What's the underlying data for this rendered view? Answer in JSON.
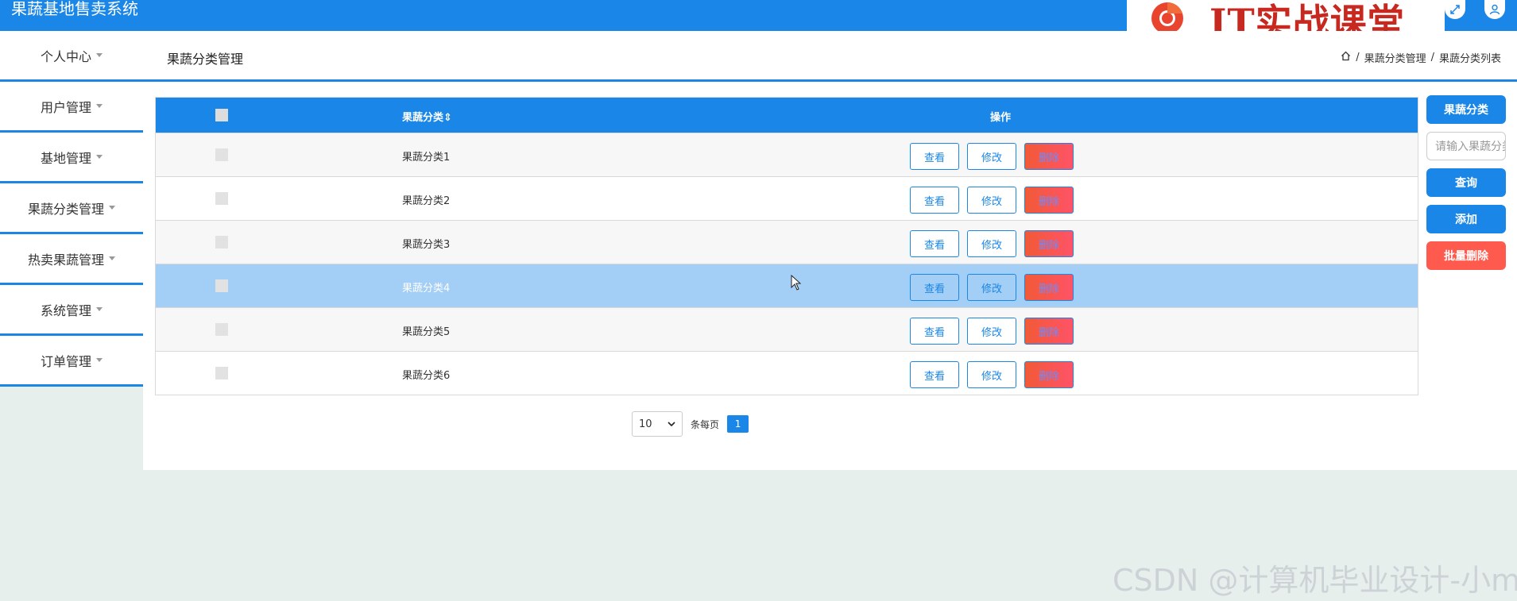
{
  "app": {
    "title": "果蔬基地售卖系统"
  },
  "watermark": {
    "banner_text": "IT实战课堂",
    "csdn_text": "CSDN @计算机毕业设计-小ma"
  },
  "icons": {
    "expand": "expand-icon",
    "user": "user-icon",
    "home": "home-icon"
  },
  "sidebar": {
    "items": [
      {
        "label": "个人中心"
      },
      {
        "label": "用户管理"
      },
      {
        "label": "基地管理"
      },
      {
        "label": "果蔬分类管理"
      },
      {
        "label": "热卖果蔬管理"
      },
      {
        "label": "系统管理"
      },
      {
        "label": "订单管理"
      }
    ]
  },
  "page": {
    "title": "果蔬分类管理",
    "breadcrumb": {
      "sep": "/",
      "level1": "果蔬分类管理",
      "level2": "果蔬分类列表"
    }
  },
  "table": {
    "header": {
      "name": "果蔬分类",
      "sort_glyph": "⇕",
      "ops": "操作"
    },
    "actions": {
      "view": "查看",
      "edit": "修改",
      "delete": "删除"
    },
    "rows": [
      {
        "name": "果蔬分类1"
      },
      {
        "name": "果蔬分类2"
      },
      {
        "name": "果蔬分类3"
      },
      {
        "name": "果蔬分类4"
      },
      {
        "name": "果蔬分类5"
      },
      {
        "name": "果蔬分类6"
      }
    ]
  },
  "pagination": {
    "page_size": "10",
    "per_page_label": "条每页",
    "current_page": "1"
  },
  "search_panel": {
    "field_label": "果蔬分类",
    "input_placeholder": "请输入果蔬分类",
    "query_label": "查询",
    "add_label": "添加",
    "batch_delete_label": "批量删除"
  },
  "colors": {
    "primary": "#1a86e8",
    "danger": "#ff5a4e",
    "row_hover": "#a3cef5",
    "page_bg": "#e6efec"
  }
}
